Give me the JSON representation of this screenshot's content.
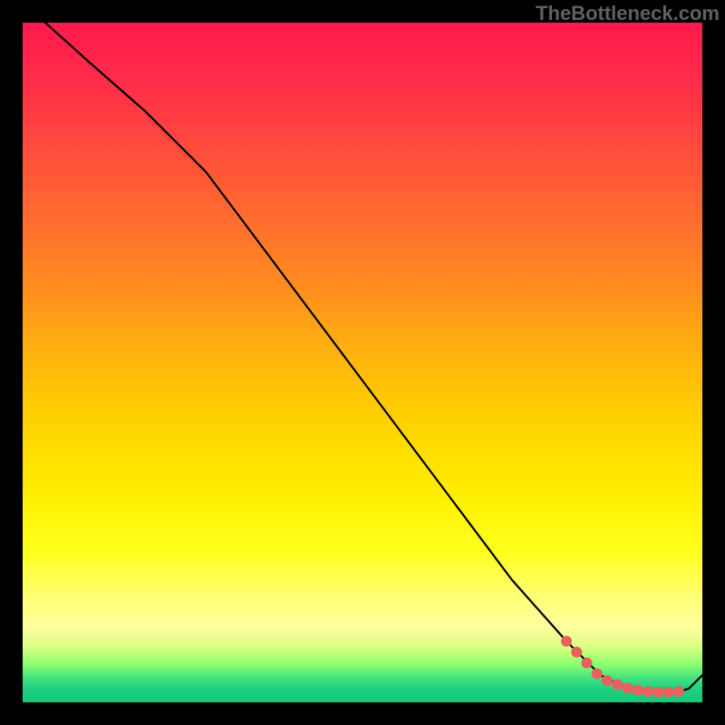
{
  "watermark": "TheBottleneck.com",
  "chart_data": {
    "type": "line",
    "title": "",
    "xlabel": "",
    "ylabel": "",
    "xlim": [
      0,
      100
    ],
    "ylim": [
      0,
      100
    ],
    "grid": false,
    "series": [
      {
        "name": "curve",
        "color": "#000000",
        "x": [
          0,
          10,
          18,
          27,
          36,
          45,
          54,
          63,
          72,
          80,
          85,
          88,
          91,
          94,
          96,
          98,
          100
        ],
        "values": [
          103,
          94,
          87,
          78,
          66,
          54,
          42,
          30,
          18,
          9,
          4,
          2.5,
          1.8,
          1.5,
          1.5,
          2,
          4
        ]
      }
    ],
    "markers": [
      {
        "name": "highlight-dots",
        "color": "#e86060",
        "points": [
          {
            "x": 80.0,
            "y": 9.0
          },
          {
            "x": 81.5,
            "y": 7.4
          },
          {
            "x": 83.0,
            "y": 5.8
          },
          {
            "x": 84.5,
            "y": 4.2
          },
          {
            "x": 86.0,
            "y": 3.2
          },
          {
            "x": 87.5,
            "y": 2.6
          },
          {
            "x": 89.0,
            "y": 2.1
          },
          {
            "x": 90.5,
            "y": 1.8
          },
          {
            "x": 92.0,
            "y": 1.6
          },
          {
            "x": 93.5,
            "y": 1.5
          },
          {
            "x": 95.0,
            "y": 1.5
          },
          {
            "x": 96.5,
            "y": 1.6
          }
        ]
      }
    ]
  }
}
